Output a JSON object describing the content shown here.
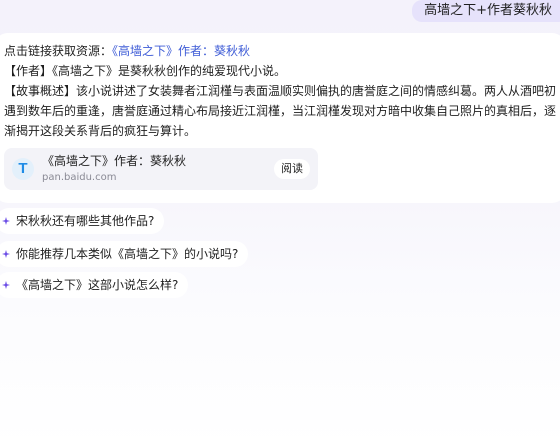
{
  "user_message": "高墙之下+作者葵秋秋",
  "answer": {
    "intro_prefix": "点击链接获取资源：",
    "intro_link": "《高墙之下》作者：葵秋秋",
    "author_line": "【作者】《高墙之下》是葵秋秋创作的纯爱现代小说。",
    "summary": "【故事概述】该小说讲述了女装舞者江润槿与表面温顺实则偏执的唐誉庭之间的情感纠葛。两人从酒吧初遇到数年后的重逢，唐誉庭通过精心布局接近江润槿，当江润槿发现对方暗中收集自己照片的真相后，逐渐揭开这段关系背后的疯狂与算计。"
  },
  "link_card": {
    "logo_letter": "T",
    "title": "《高墙之下》作者：葵秋秋",
    "domain": "pan.baidu.com",
    "button_label": "阅读"
  },
  "suggestions": [
    "宋秋秋还有哪些其他作品?",
    "你能推荐几本类似《高墙之下》的小说吗?",
    "《高墙之下》这部小说怎么样?"
  ],
  "colors": {
    "accent": "#3d5bd6",
    "sparkle": "#6b4ce6",
    "user_bubble": "#e6e2fb"
  },
  "icons": {
    "suggestion_bullet": "sparkle-icon",
    "link_card_logo": "document-t-icon"
  }
}
